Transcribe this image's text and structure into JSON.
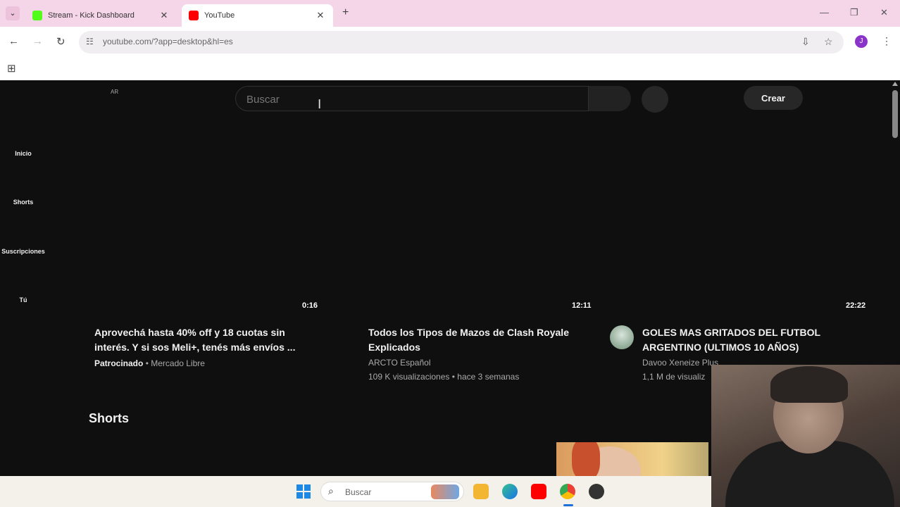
{
  "browser": {
    "tabs": [
      {
        "title": "Stream - Kick Dashboard",
        "favicon_color": "#53fc18",
        "active": false
      },
      {
        "title": "YouTube",
        "favicon_color": "#ff0000",
        "active": true
      }
    ],
    "url": "youtube.com/?app=desktop&hl=es",
    "profile_initial": "J"
  },
  "youtube": {
    "country_code": "AR",
    "search_placeholder": "Buscar",
    "create_label": "Crear",
    "sidebar": [
      {
        "label": "Inicio"
      },
      {
        "label": "Shorts"
      },
      {
        "label": "Suscripciones"
      },
      {
        "label": "Tú"
      }
    ],
    "videos": [
      {
        "duration": "0:16",
        "title_line1": "Aprovechá hasta 40% off y 18 cuotas sin",
        "title_line2": "interés. Y si sos Meli+, tenés más envíos ...",
        "sponsored": "Patrocinado",
        "channel": "• Mercado Libre",
        "stats": ""
      },
      {
        "duration": "12:11",
        "title_line1": "Todos los Tipos de Mazos de Clash Royale",
        "title_line2": "Explicados",
        "channel": "ARCTO Español",
        "stats": "109 K visualizaciones • hace 3 semanas"
      },
      {
        "duration": "22:22",
        "title_line1": "GOLES MAS GRITADOS DEL FUTBOL",
        "title_line2": "ARGENTINO (ULTIMOS 10 AÑOS)",
        "channel": "Davoo Xeneize Plus",
        "stats": "1,1 M de visualiz"
      }
    ],
    "shorts_heading": "Shorts"
  },
  "taskbar": {
    "search_label": "Buscar"
  }
}
